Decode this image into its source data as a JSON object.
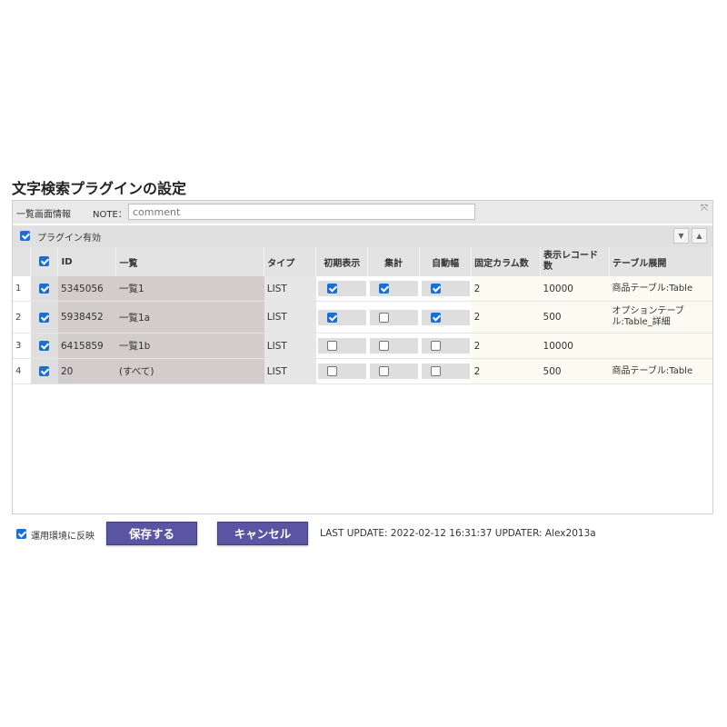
{
  "page_title": "文字検索プラグインの設定",
  "note_bar": {
    "section_label": "一覧画面情報",
    "note_label": "NOTE：",
    "note_placeholder": "comment",
    "expand_icon": "expand-icon"
  },
  "plugin_bar": {
    "enabled": true,
    "label": "プラグイン有効",
    "sort_down_icon": "arrow-down-icon",
    "sort_up_icon": "arrow-up-icon"
  },
  "table": {
    "headers": {
      "id": "ID",
      "list": "一覧",
      "type": "タイプ",
      "initial_display": "初期表示",
      "aggregate": "集計",
      "auto_width": "自動幅",
      "fixed_columns": "固定カラム数",
      "record_count": "表示レコード数",
      "table_expand": "テーブル展開"
    },
    "header_checked": true,
    "rows": [
      {
        "num": "1",
        "checked": true,
        "id": "5345056",
        "list": "一覧1",
        "type": "LIST",
        "initial": true,
        "aggregate": true,
        "auto_width": true,
        "fixed": "2",
        "records": "10000",
        "expand": "商品テーブル:Table"
      },
      {
        "num": "2",
        "checked": true,
        "id": "5938452",
        "list": "一覧1a",
        "type": "LIST",
        "initial": true,
        "aggregate": false,
        "auto_width": true,
        "fixed": "2",
        "records": "500",
        "expand": "オプションテーブル:Table_詳細"
      },
      {
        "num": "3",
        "checked": true,
        "id": "6415859",
        "list": "一覧1b",
        "type": "LIST",
        "initial": false,
        "aggregate": false,
        "auto_width": false,
        "fixed": "2",
        "records": "10000",
        "expand": ""
      },
      {
        "num": "4",
        "checked": true,
        "id": "20",
        "list": "(すべて)",
        "type": "LIST",
        "initial": false,
        "aggregate": false,
        "auto_width": false,
        "fixed": "2",
        "records": "500",
        "expand": "商品テーブル:Table"
      }
    ]
  },
  "footer": {
    "reflect_checked": true,
    "reflect_label": "運用環境に反映",
    "save_label": "保存する",
    "cancel_label": "キャンセル",
    "status": "LAST UPDATE: 2022-02-12 16:31:37 UPDATER: Alex2013a"
  },
  "colors": {
    "button": "#5955a3",
    "checkbox": "#1a6fd6"
  }
}
